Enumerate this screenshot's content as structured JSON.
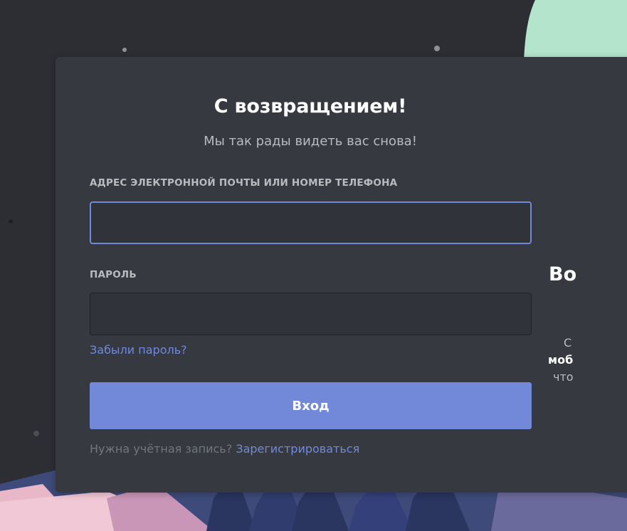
{
  "login": {
    "title": "С возвращением!",
    "subtitle": "Мы так рады видеть вас снова!",
    "email_label": "АДРЕС ЭЛЕКТРОННОЙ ПОЧТЫ ИЛИ НОМЕР ТЕЛЕФОНА",
    "email_value": "",
    "password_label": "ПАРОЛЬ",
    "password_value": "",
    "forgot_password": "Забыли пароль?",
    "login_button": "Вход",
    "need_account": "Нужна учётная запись?",
    "register_link": "Зарегистрироваться"
  },
  "qr_panel": {
    "title_visible": "Во",
    "desc_line1": "С",
    "desc_line2": "моб",
    "desc_line3": "что"
  },
  "colors": {
    "background": "#2c2e34",
    "card": "#36393f",
    "accent": "#7289da",
    "input_bg": "#303339",
    "mint": "#b4e5cc"
  }
}
